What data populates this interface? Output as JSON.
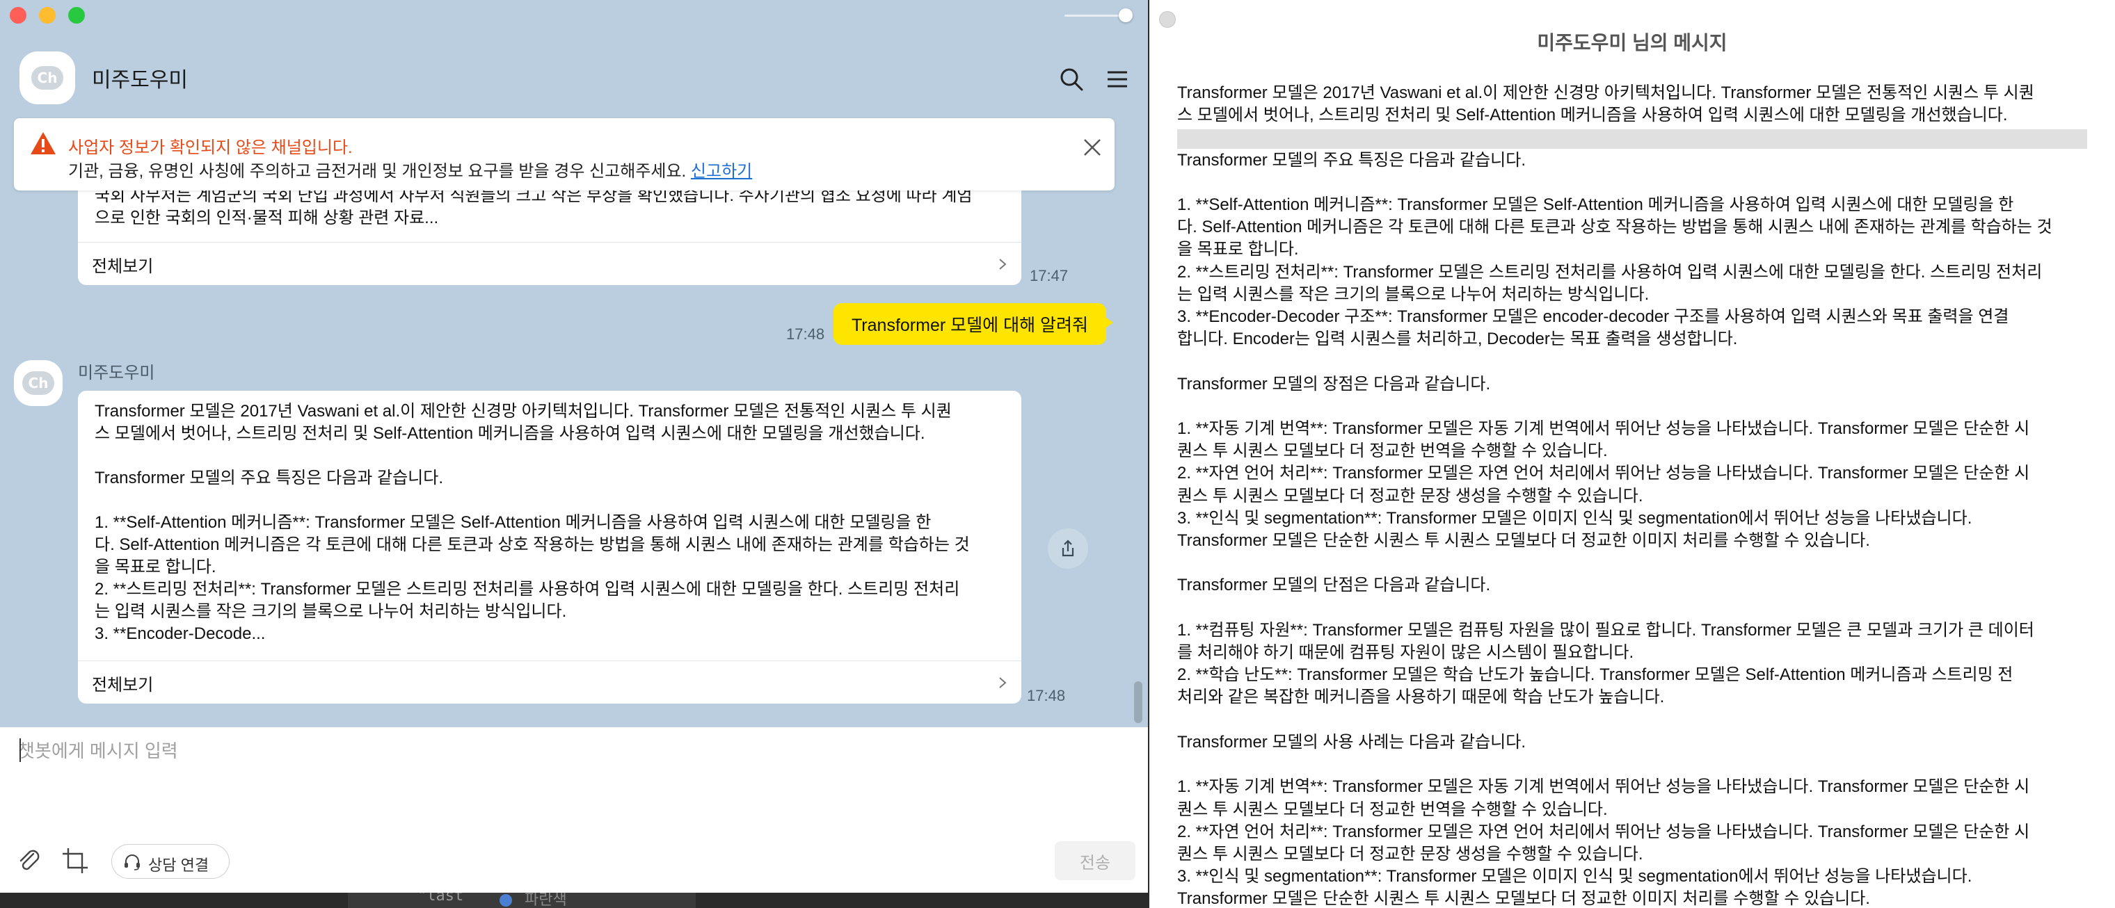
{
  "chat_window": {
    "title": "미주도우미",
    "avatar_label": "Ch",
    "warning": {
      "title": "사업자 정보가 확인되지 않은 채널입니다.",
      "body": "기관, 금융, 유명인 사칭에 주의하고 금전거래 및 개인정보 요구를 받을 경우 신고해주세요.",
      "report_link": "신고하기"
    },
    "messages": [
      {
        "sender": "bot",
        "text": "국회 사무처는 계엄군의 국회 난입 과정에서 사무처 직원들의 크고 작은 부상을 확인했습니다. 수사기관의 협조 요청에 따라 계엄\n으로 인한 국회의 인적·물적 피해 상황 관련 자료...",
        "more_label": "전체보기",
        "time": "17:47"
      },
      {
        "sender": "me",
        "text": "Transformer 모델에 대해 알려줘",
        "time": "17:48"
      },
      {
        "sender": "bot",
        "name": "미주도우미",
        "text": "Transformer 모델은 2017년 Vaswani et al.이 제안한 신경망 아키텍처입니다. Transformer 모델은 전통적인 시퀀스 투 시퀀\n스 모델에서 벗어나, 스트리밍 전처리 및 Self-Attention 메커니즘을 사용하여 입력 시퀀스에 대한 모델링을 개선했습니다.\n\nTransformer 모델의 주요 특징은 다음과 같습니다.\n\n1. **Self-Attention 메커니즘**: Transformer 모델은 Self-Attention 메커니즘을 사용하여 입력 시퀀스에 대한 모델링을 한\n다. Self-Attention 메커니즘은 각 토큰에 대해 다른 토큰과 상호 작용하는 방법을 통해 시퀀스 내에 존재하는 관계를 학습하는 것\n을 목표로 합니다.\n2. **스트리밍 전처리**: Transformer 모델은 스트리밍 전처리를 사용하여 입력 시퀀스에 대한 모델링을 한다. 스트리밍 전처리\n는 입력 시퀀스를 작은 크기의 블록으로 나누어 처리하는 방식입니다.\n3. **Encoder-Decode...",
        "more_label": "전체보기",
        "time": "17:48"
      }
    ],
    "composer": {
      "placeholder": "챗봇에게 메시지 입력",
      "consult_label": "상담 연결",
      "send_label": "전송"
    }
  },
  "viewer": {
    "title": "미주도우미 님의 메시지",
    "text": "Transformer 모델은 2017년 Vaswani et al.이 제안한 신경망 아키텍처입니다. Transformer 모델은 전통적인 시퀀스 투 시퀀\n스 모델에서 벗어나, 스트리밍 전처리 및 Self-Attention 메커니즘을 사용하여 입력 시퀀스에 대한 모델링을 개선했습니다.\n\nTransformer 모델의 주요 특징은 다음과 같습니다.\n\n1. **Self-Attention 메커니즘**: Transformer 모델은 Self-Attention 메커니즘을 사용하여 입력 시퀀스에 대한 모델링을 한\n다. Self-Attention 메커니즘은 각 토큰에 대해 다른 토큰과 상호 작용하는 방법을 통해 시퀀스 내에 존재하는 관계를 학습하는 것\n을 목표로 합니다.\n2. **스트리밍 전처리**: Transformer 모델은 스트리밍 전처리를 사용하여 입력 시퀀스에 대한 모델링을 한다. 스트리밍 전처리\n는 입력 시퀀스를 작은 크기의 블록으로 나누어 처리하는 방식입니다.\n3. **Encoder-Decoder 구조**: Transformer 모델은 encoder-decoder 구조를 사용하여 입력 시퀀스와 목표 출력을 연결\n합니다. Encoder는 입력 시퀀스를 처리하고, Decoder는 목표 출력을 생성합니다.\n\nTransformer 모델의 장점은 다음과 같습니다.\n\n1. **자동 기계 번역**: Transformer 모델은 자동 기계 번역에서 뛰어난 성능을 나타냈습니다. Transformer 모델은 단순한 시\n퀀스 투 시퀀스 모델보다 더 정교한 번역을 수행할 수 있습니다.\n2. **자연 언어 처리**: Transformer 모델은 자연 언어 처리에서 뛰어난 성능을 나타냈습니다. Transformer 모델은 단순한 시\n퀀스 투 시퀀스 모델보다 더 정교한 문장 생성을 수행할 수 있습니다.\n3. **인식 및 segmentation**: Transformer 모델은 이미지 인식 및 segmentation에서 뛰어난 성능을 나타냈습니다.\nTransformer 모델은 단순한 시퀀스 투 시퀀스 모델보다 더 정교한 이미지 처리를 수행할 수 있습니다.\n\nTransformer 모델의 단점은 다음과 같습니다.\n\n1. **컴퓨팅 자원**: Transformer 모델은 컴퓨팅 자원을 많이 필요로 합니다. Transformer 모델은 큰 모델과 크기가 큰 데이터\n를 처리해야 하기 때문에 컴퓨팅 자원이 많은 시스템이 필요합니다.\n2. **학습 난도**: Transformer 모델은 학습 난도가 높습니다. Transformer 모델은 Self-Attention 메커니즘과 스트리밍 전\n처리와 같은 복잡한 메커니즘을 사용하기 때문에 학습 난도가 높습니다.\n\nTransformer 모델의 사용 사례는 다음과 같습니다.\n\n1. **자동 기계 번역**: Transformer 모델은 자동 기계 번역에서 뛰어난 성능을 나타냈습니다. Transformer 모델은 단순한 시\n퀀스 투 시퀀스 모델보다 더 정교한 번역을 수행할 수 있습니다.\n2. **자연 언어 처리**: Transformer 모델은 자연 언어 처리에서 뛰어난 성능을 나타냈습니다. Transformer 모델은 단순한 시\n퀀스 투 시퀀스 모델보다 더 정교한 문장 생성을 수행할 수 있습니다.\n3. **인식 및 segmentation**: Transformer 모델은 이미지 인식 및 segmentation에서 뛰어난 성능을 나타냈습니다.\nTransformer 모델은 단순한 시퀀스 투 시퀀스 모델보다 더 정교한 이미지 처리를 수행할 수 있습니다."
  },
  "background": {
    "code_snippet": "\"last",
    "label": "파란색"
  },
  "colors": {
    "chat_background": "#bacee0",
    "my_bubble": "#fee500",
    "warning_text": "#e64a19",
    "link": "#1f6fd1"
  }
}
